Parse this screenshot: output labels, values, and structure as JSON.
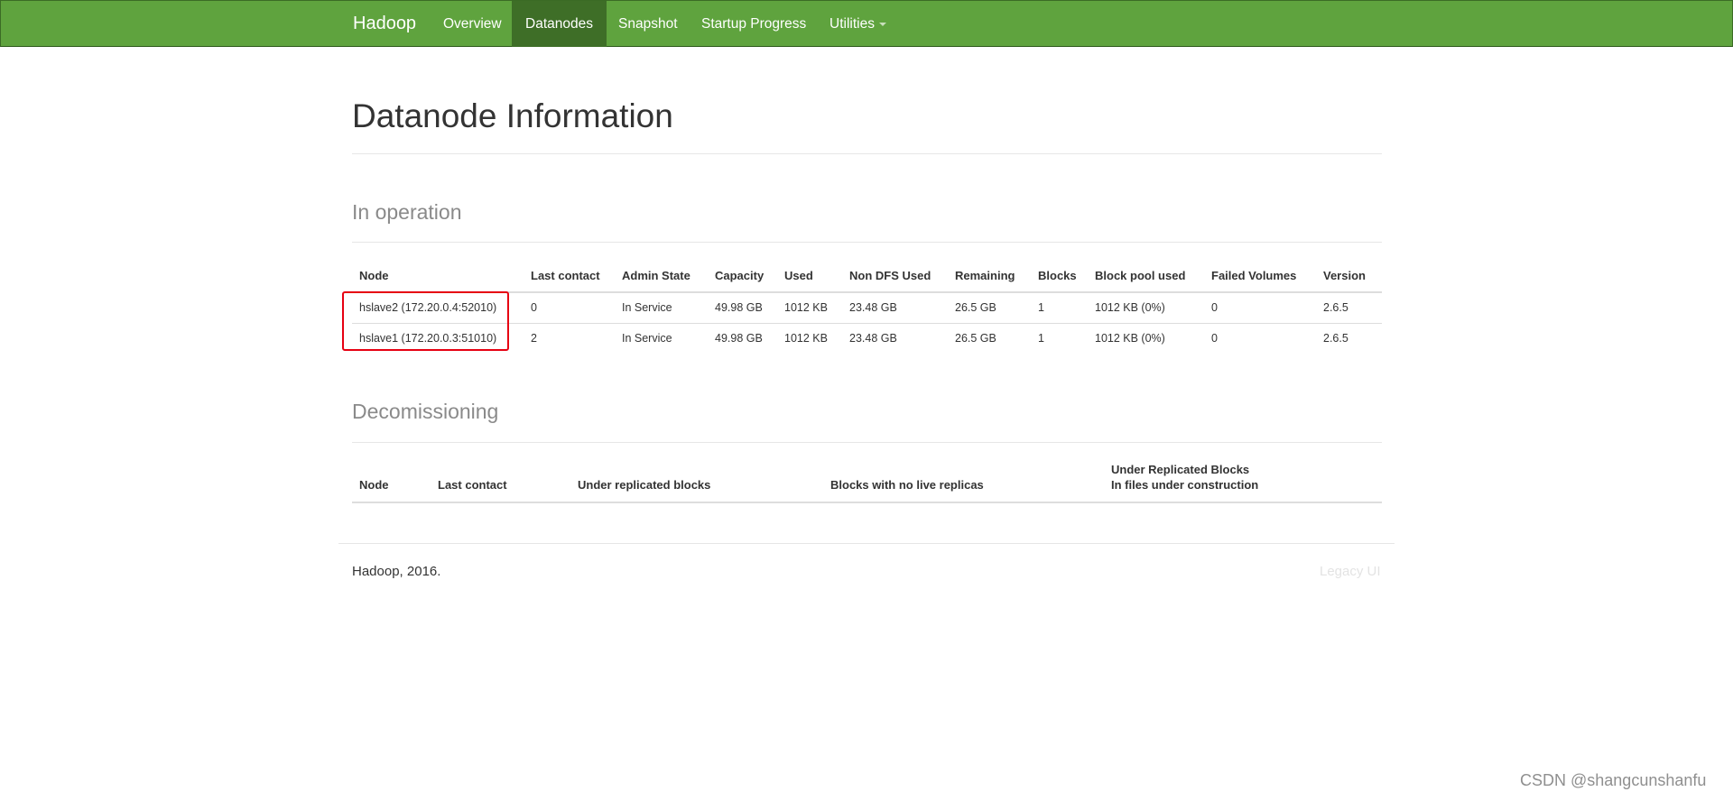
{
  "navbar": {
    "brand": "Hadoop",
    "items": [
      {
        "label": "Overview"
      },
      {
        "label": "Datanodes"
      },
      {
        "label": "Snapshot"
      },
      {
        "label": "Startup Progress"
      },
      {
        "label": "Utilities"
      }
    ],
    "active": "Datanodes"
  },
  "page": {
    "title": "Datanode Information"
  },
  "in_operation": {
    "title": "In operation",
    "columns": [
      "Node",
      "Last contact",
      "Admin State",
      "Capacity",
      "Used",
      "Non DFS Used",
      "Remaining",
      "Blocks",
      "Block pool used",
      "Failed Volumes",
      "Version"
    ],
    "rows": [
      [
        "hslave2 (172.20.0.4:52010)",
        "0",
        "In Service",
        "49.98 GB",
        "1012 KB",
        "23.48 GB",
        "26.5 GB",
        "1",
        "1012 KB (0%)",
        "0",
        "2.6.5"
      ],
      [
        "hslave1 (172.20.0.3:51010)",
        "2",
        "In Service",
        "49.98 GB",
        "1012 KB",
        "23.48 GB",
        "26.5 GB",
        "1",
        "1012 KB (0%)",
        "0",
        "2.6.5"
      ]
    ]
  },
  "decommissioning": {
    "title": "Decomissioning",
    "columns": [
      "Node",
      "Last contact",
      "Under replicated blocks",
      "Blocks with no live replicas",
      "Under Replicated Blocks",
      "In files under construction"
    ]
  },
  "footer": {
    "text": "Hadoop, 2016.",
    "legacy_link": "Legacy UI"
  },
  "watermark": "CSDN @shangcunshanfu",
  "colors": {
    "navbar": "#5fa33e",
    "navbar_active": "#3e6e27",
    "highlight": "#e60012"
  }
}
